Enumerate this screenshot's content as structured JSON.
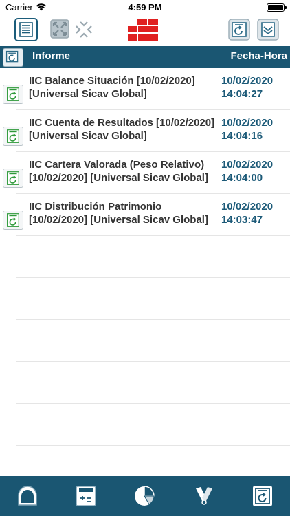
{
  "status": {
    "carrier": "Carrier",
    "time": "4:59 PM"
  },
  "toolbar": {
    "icons": [
      "report-list-icon",
      "expand-icon",
      "collapse-icon",
      "grid-icon",
      "refresh-icon",
      "download-icon"
    ]
  },
  "table": {
    "col_informe": "Informe",
    "col_fecha": "Fecha-Hora",
    "rows": [
      {
        "title": "IIC Balance Situación [10/02/2020] [Universal Sicav Global]",
        "date": "10/02/2020",
        "time": "14:04:27"
      },
      {
        "title": "IIC Cuenta de Resultados [10/02/2020] [Universal Sicav Global]",
        "date": "10/02/2020",
        "time": "14:04:16"
      },
      {
        "title": "IIC Cartera Valorada (Peso Relativo) [10/02/2020] [Universal Sicav Global]",
        "date": "10/02/2020",
        "time": "14:04:00"
      },
      {
        "title": "IIC Distribución Patrimonio [10/02/2020] [Universal Sicav Global]",
        "date": "10/02/2020",
        "time": "14:03:47"
      }
    ]
  },
  "tabbar": {
    "items": [
      "home-icon",
      "calculator-icon",
      "pie-chart-icon",
      "tools-icon",
      "reports-icon"
    ]
  },
  "colors": {
    "header_bg": "#1a5672",
    "accent_green": "#2e9a3a",
    "grid_red": "#e02020",
    "date_text": "#1c5a78"
  }
}
